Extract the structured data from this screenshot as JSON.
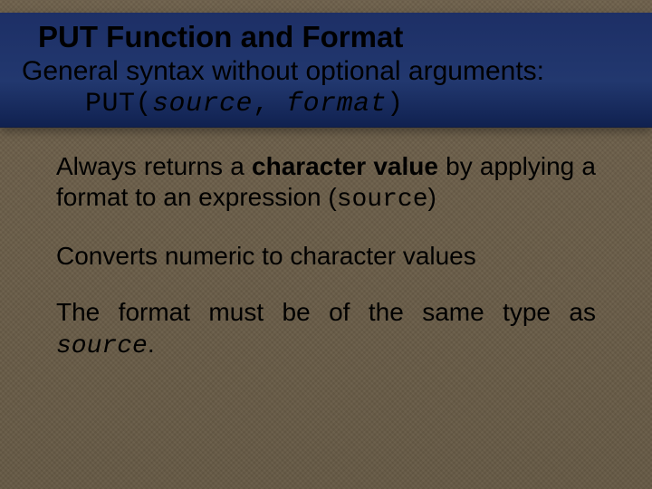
{
  "title": "PUT Function and Format",
  "subtitle": "General syntax without optional arguments:",
  "syntax": {
    "fn": "PUT",
    "open": "(",
    "arg1": "source",
    "sep": ", ",
    "arg2": "format",
    "close": ")"
  },
  "p1": {
    "t1": "Always returns a ",
    "bold": "character value",
    "t2": " by applying a format to an expression (",
    "code": "source",
    "t3": ")"
  },
  "p2": "Converts numeric to character values",
  "p3": {
    "t1": "The format must be of the same type as ",
    "code": "source",
    "t2": "."
  }
}
